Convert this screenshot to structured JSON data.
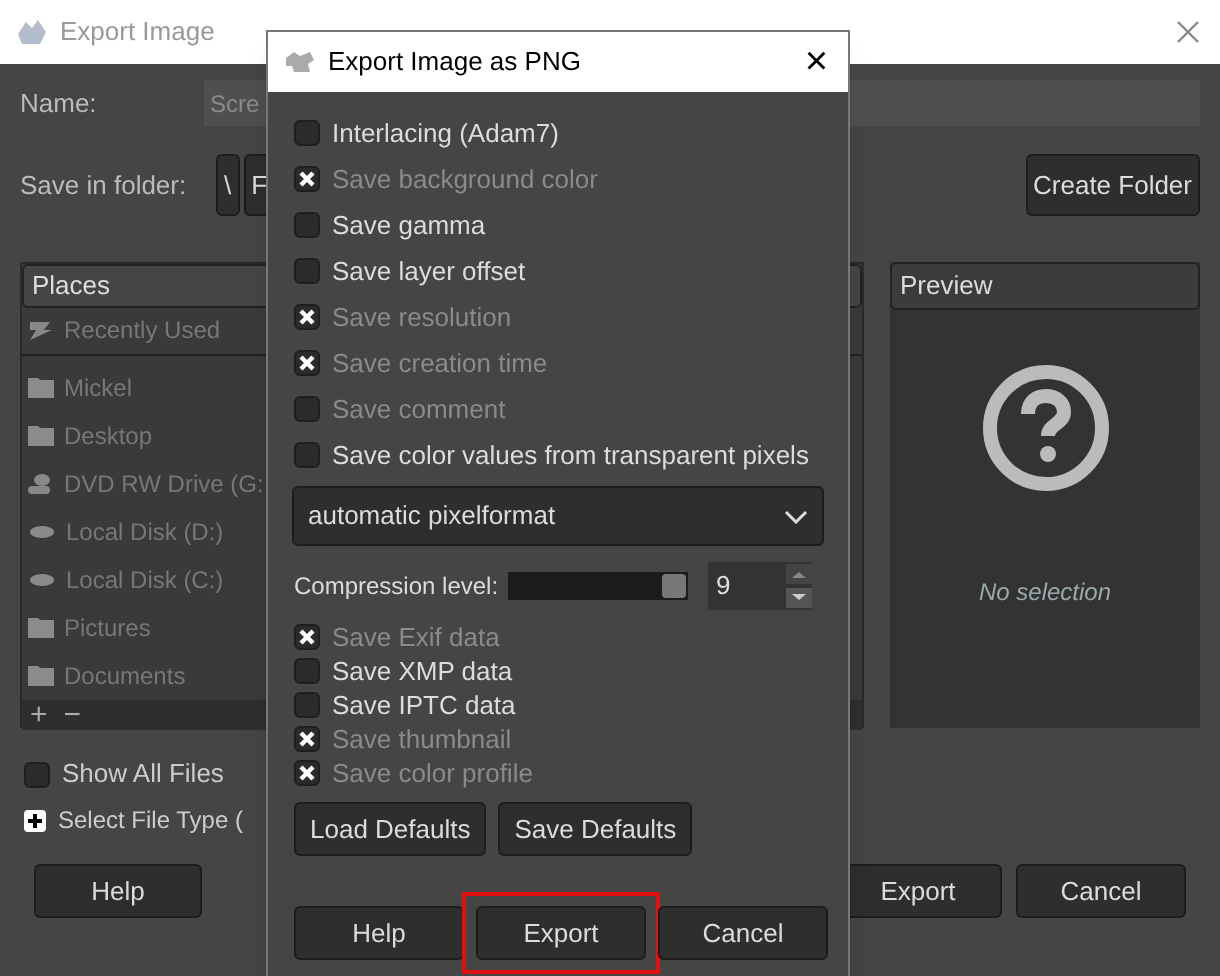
{
  "main_window": {
    "title": "Export Image",
    "name_label": "Name:",
    "name_value": "Scre",
    "folder_label": "Save in folder:",
    "path_buttons": [
      "\\",
      "F"
    ],
    "create_folder": "Create Folder",
    "places": {
      "header": "Places",
      "items": [
        {
          "label": "Recently Used",
          "kind": "recent"
        },
        {
          "label": "Mickel",
          "kind": "folder"
        },
        {
          "label": "Desktop",
          "kind": "folder"
        },
        {
          "label": "DVD RW Drive (G:",
          "kind": "disc"
        },
        {
          "label": "Local Disk (D:)",
          "kind": "disk"
        },
        {
          "label": "Local Disk (C:)",
          "kind": "disk"
        },
        {
          "label": "Pictures",
          "kind": "folder"
        },
        {
          "label": "Documents",
          "kind": "folder"
        }
      ],
      "add": "+",
      "remove": "−"
    },
    "preview": {
      "header": "Preview",
      "message": "No selection"
    },
    "show_all_files": {
      "label": "Show All Files",
      "checked": false
    },
    "file_type": {
      "label": "Select File Type (",
      "expanded": false
    },
    "buttons": [
      "Help",
      "Export",
      "Cancel"
    ]
  },
  "dialog": {
    "title": "Export Image as PNG",
    "close": "×",
    "options": [
      {
        "label": "Interlacing (Adam7)",
        "checked": false,
        "disabled": false
      },
      {
        "label": "Save background color",
        "checked": true,
        "disabled": true
      },
      {
        "label": "Save gamma",
        "checked": false,
        "disabled": false
      },
      {
        "label": "Save layer offset",
        "checked": false,
        "disabled": false
      },
      {
        "label": "Save resolution",
        "checked": true,
        "disabled": true
      },
      {
        "label": "Save creation time",
        "checked": true,
        "disabled": true
      },
      {
        "label": "Save comment",
        "checked": false,
        "disabled": true
      },
      {
        "label": "Save color values from transparent pixels",
        "checked": false,
        "disabled": false
      }
    ],
    "pixelformat": "automatic pixelformat",
    "compression": {
      "label": "Compression level:",
      "level": 1,
      "value": "9"
    },
    "metadata": [
      {
        "label": "Save Exif data",
        "checked": true,
        "disabled": true
      },
      {
        "label": "Save XMP data",
        "checked": false,
        "disabled": false
      },
      {
        "label": "Save IPTC data",
        "checked": false,
        "disabled": false
      },
      {
        "label": "Save thumbnail",
        "checked": true,
        "disabled": true
      },
      {
        "label": "Save color profile",
        "checked": true,
        "disabled": true
      }
    ],
    "default_buttons": [
      "Load Defaults",
      "Save Defaults"
    ],
    "buttons": [
      {
        "label": "Help",
        "highlighted": false
      },
      {
        "label": "Export",
        "highlighted": true
      },
      {
        "label": "Cancel",
        "highlighted": false
      }
    ]
  }
}
